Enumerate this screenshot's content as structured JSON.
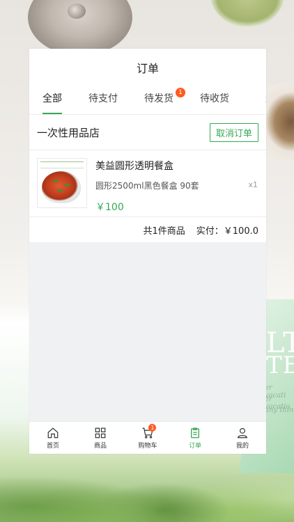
{
  "header": {
    "title": "订单"
  },
  "tabs": [
    {
      "label": "全部",
      "active": true
    },
    {
      "label": "待支付",
      "active": false
    },
    {
      "label": "待发货",
      "active": false,
      "badge": "1"
    },
    {
      "label": "待收货",
      "active": false
    },
    {
      "label": "退",
      "active": false
    }
  ],
  "order": {
    "shop_name": "一次性用品店",
    "cancel_label": "取消订单",
    "item": {
      "title": "美益圆形透明餐盒",
      "spec": "圆形2500ml黑色餐盒 90套",
      "price": "￥100",
      "qty": "x1"
    },
    "summary": {
      "count": "共1件商品",
      "paid": "实付：￥100.0"
    }
  },
  "bottom_nav": [
    {
      "label": "首页",
      "icon": "home-icon",
      "active": false
    },
    {
      "label": "商品",
      "icon": "grid-icon",
      "active": false
    },
    {
      "label": "购物车",
      "icon": "cart-icon",
      "active": false,
      "badge": "1"
    },
    {
      "label": "订单",
      "icon": "clipboard-icon",
      "active": true
    },
    {
      "label": "我的",
      "icon": "user-icon",
      "active": false
    }
  ],
  "background": {
    "text_line1": "LTH",
    "text_line2": "TEA",
    "text_small1": "er vacati",
    "text_small2": "er vacatio",
    "text_small3": "any thin"
  },
  "colors": {
    "accent": "#35a853",
    "badge": "#ff5a1f"
  }
}
